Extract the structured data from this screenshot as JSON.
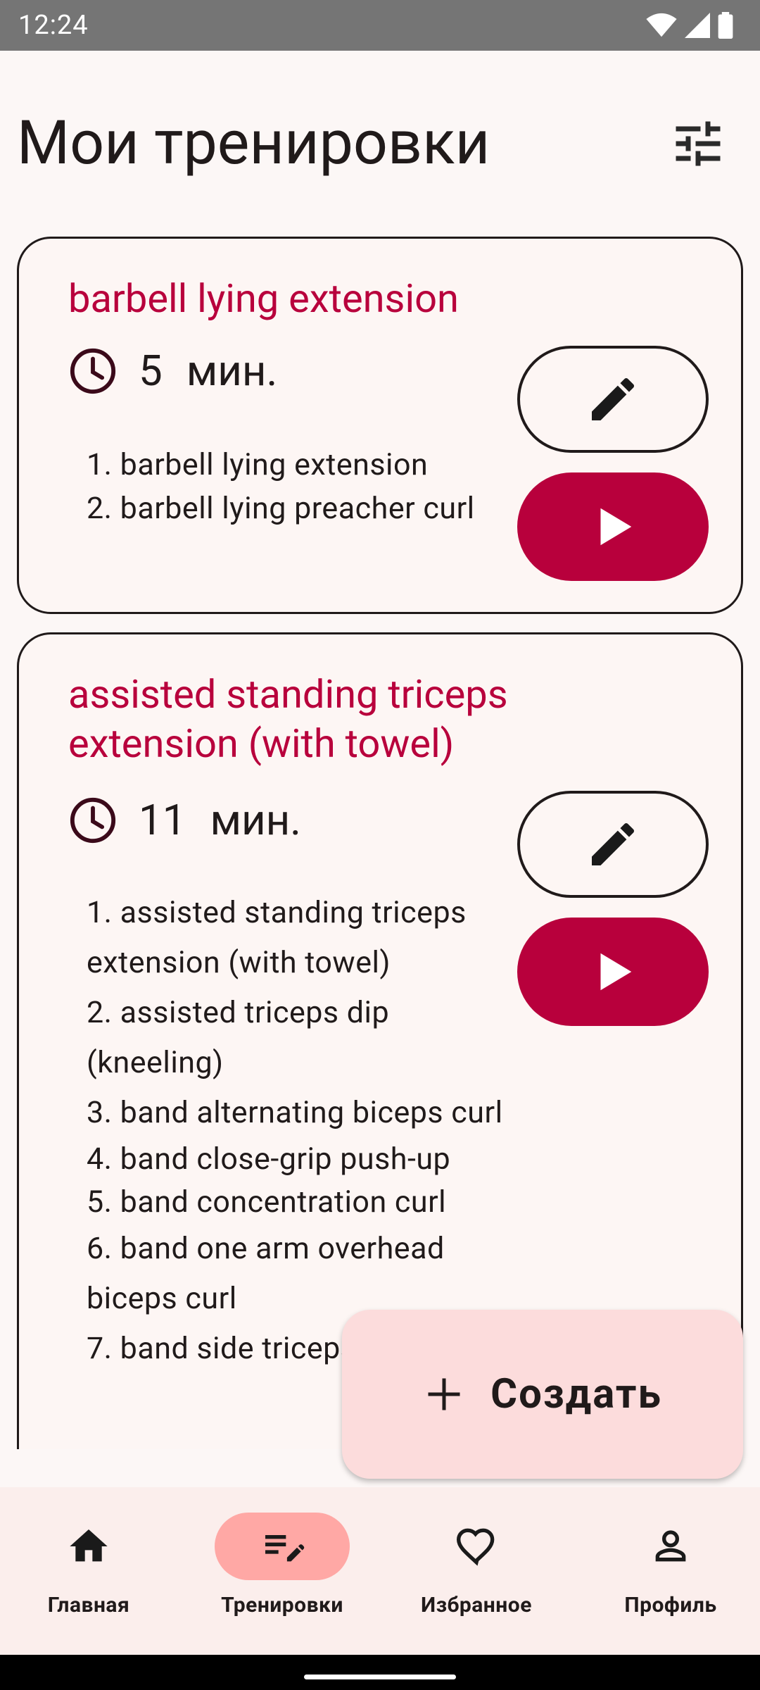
{
  "status_bar": {
    "time": "12:24"
  },
  "header": {
    "title": "Мои тренировки"
  },
  "workouts": [
    {
      "title": "barbell lying extension",
      "duration_value": "5",
      "duration_unit": "мин.",
      "exercises": [
        "1. barbell lying extension",
        "2. barbell lying preacher curl"
      ]
    },
    {
      "title": "assisted standing triceps extension (with towel)",
      "duration_value": "11",
      "duration_unit": "мин.",
      "exercises": [
        "1. assisted standing triceps extension (with towel)",
        "2. assisted triceps dip (kneeling)",
        "3. band alternating biceps curl",
        "4. band close-grip push-up",
        "5. band concentration curl",
        "6. band one arm overhead biceps curl",
        "7. band side triceps extension"
      ]
    }
  ],
  "fab": {
    "label": "Создать"
  },
  "nav": {
    "items": [
      {
        "label": "Главная",
        "icon": "home-icon",
        "active": false
      },
      {
        "label": "Тренировки",
        "icon": "edit-note-icon",
        "active": true
      },
      {
        "label": "Избранное",
        "icon": "heart-icon",
        "active": false
      },
      {
        "label": "Профиль",
        "icon": "person-icon",
        "active": false
      }
    ]
  },
  "colors": {
    "accent": "#b8003c",
    "fab_bg": "#fcdcdc",
    "nav_active_pill": "#ffa8a5",
    "nav_bg": "#fbeeec"
  }
}
